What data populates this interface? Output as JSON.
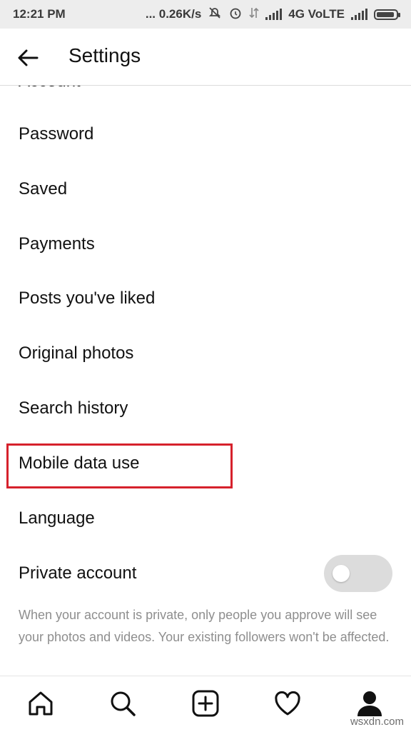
{
  "status_bar": {
    "time": "12:21 PM",
    "speed": "... 0.26K/s",
    "network": "4G VoLTE"
  },
  "header": {
    "title": "Settings",
    "back_icon": "back-arrow-icon"
  },
  "settings": {
    "partial_item": "Account",
    "items": [
      {
        "label": "Password"
      },
      {
        "label": "Saved"
      },
      {
        "label": "Payments"
      },
      {
        "label": "Posts you've liked"
      },
      {
        "label": "Original photos"
      },
      {
        "label": "Search history"
      },
      {
        "label": "Mobile data use"
      },
      {
        "label": "Language"
      },
      {
        "label": "Private account"
      }
    ],
    "private_account_enabled": false,
    "private_description": "When your account is private, only people you approve will see your photos and videos. Your existing followers won't be affected.",
    "highlight_color": "#d6212c"
  },
  "bottom_nav": {
    "icons": [
      "home-icon",
      "search-icon",
      "add-post-icon",
      "heart-icon",
      "profile-icon"
    ]
  },
  "watermark": "wsxdn.com"
}
